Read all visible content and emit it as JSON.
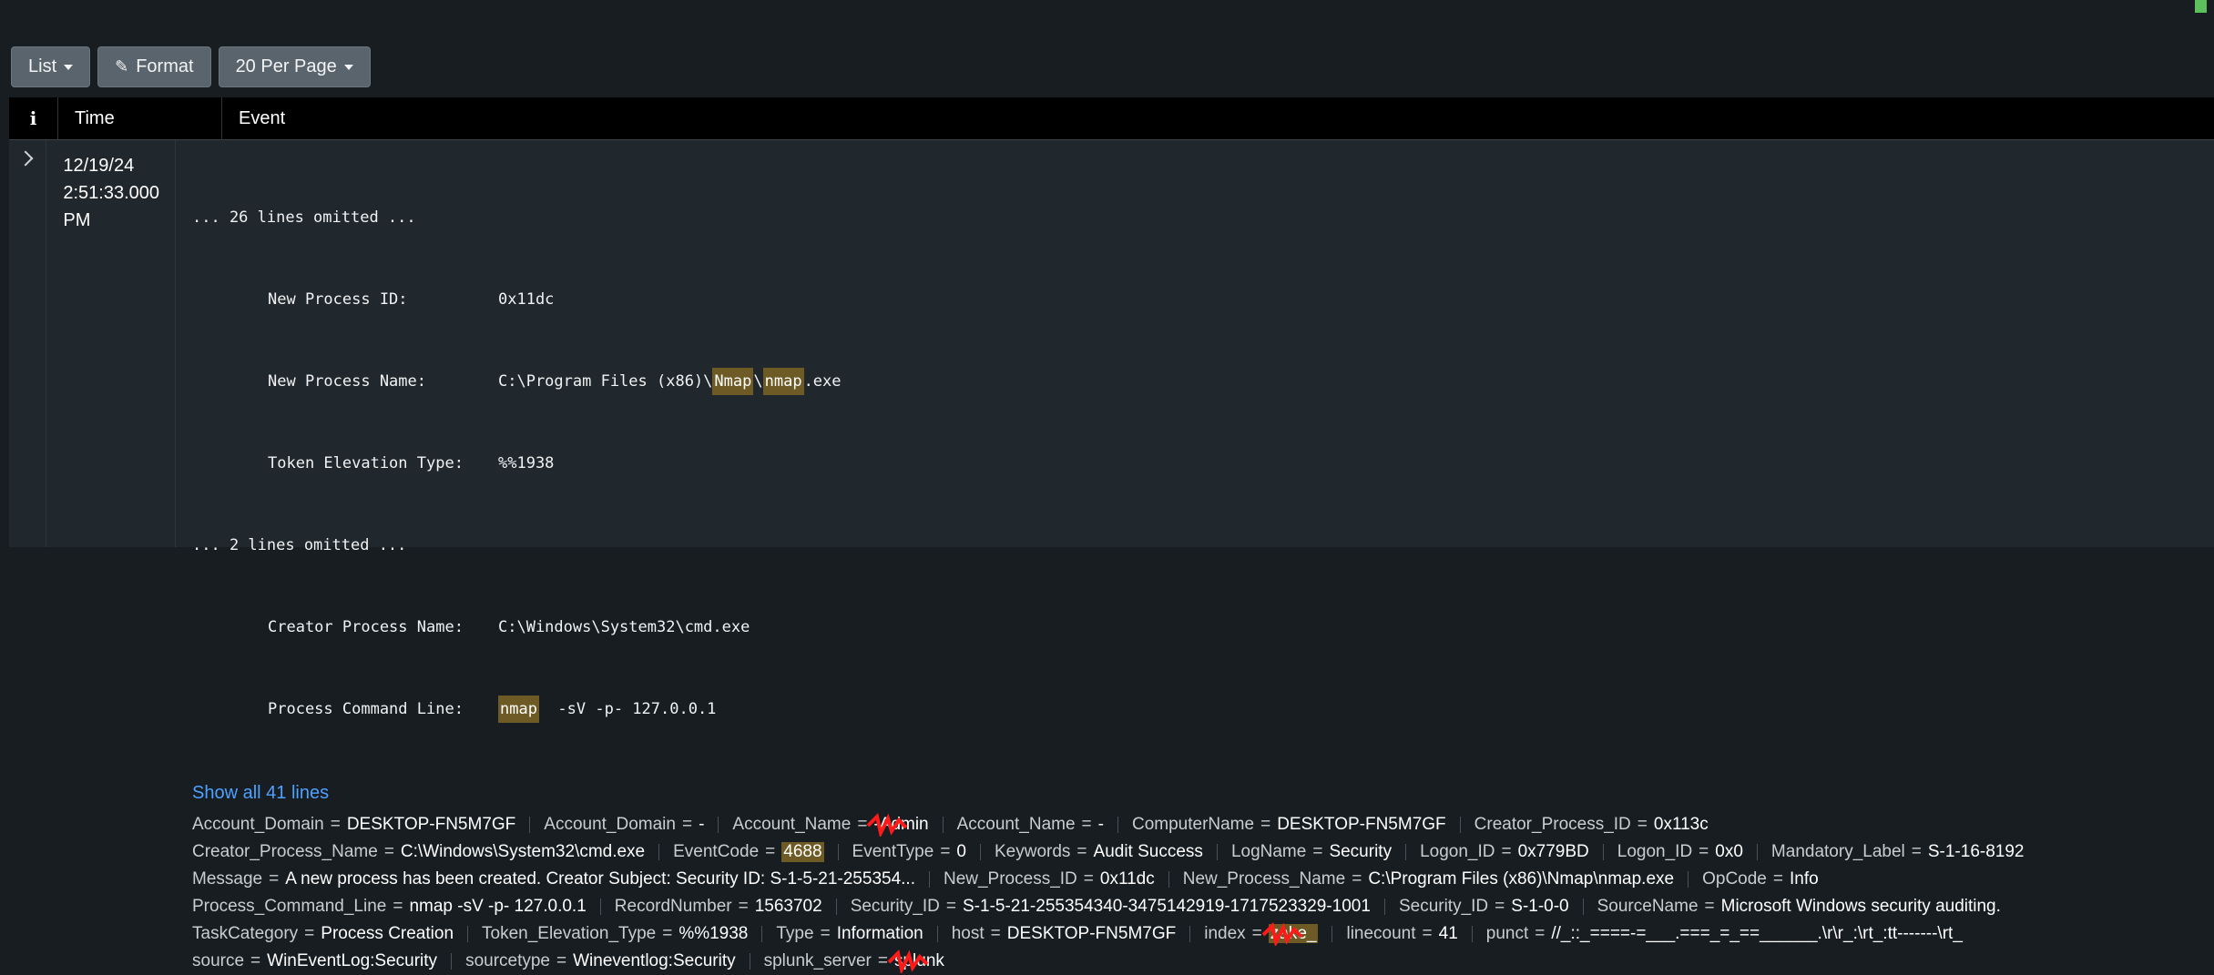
{
  "toolbar": {
    "list_label": "List",
    "format_label": "Format",
    "perpage_label": "20 Per Page"
  },
  "table": {
    "col_info": "i",
    "col_time": "Time",
    "col_event": "Event"
  },
  "event": {
    "date": "12/19/24",
    "time": "2:51:33.000 PM",
    "omitted1": "... 26 lines omitted ...",
    "omitted2": "... 2 lines omitted ...",
    "lines": [
      {
        "label": "New Process ID:",
        "value": "0x11dc"
      },
      {
        "label": "New Process Name:",
        "value_pre": "C:\\Program Files (x86)\\",
        "hl1": "Nmap",
        "value_mid": "\\",
        "hl2": "nmap",
        "value_post": ".exe"
      },
      {
        "label": "Token Elevation Type:",
        "value": "%%1938"
      },
      {
        "label": "Creator Process Name:",
        "value": "C:\\Windows\\System32\\cmd.exe"
      },
      {
        "label": "Process Command Line:",
        "hl": "nmap",
        "value_post": "  -sV -p- 127.0.0.1"
      }
    ],
    "show_all": "Show all 41 lines"
  },
  "fields": {
    "r1": [
      [
        "Account_Domain",
        "DESKTOP-FN5M7GF"
      ],
      [
        "Account_Domain",
        "-"
      ],
      [
        "Account_Name",
        "-Admin"
      ],
      [
        "Account_Name",
        "-"
      ],
      [
        "ComputerName",
        "DESKTOP-FN5M7GF"
      ],
      [
        "Creator_Process_ID",
        "0x113c"
      ]
    ],
    "r2": [
      [
        "Creator_Process_Name",
        "C:\\Windows\\System32\\cmd.exe"
      ],
      [
        "EventCode",
        "4688"
      ],
      [
        "EventType",
        "0"
      ],
      [
        "Keywords",
        "Audit Success"
      ],
      [
        "LogName",
        "Security"
      ],
      [
        "Logon_ID",
        "0x779BD"
      ],
      [
        "Logon_ID",
        "0x0"
      ],
      [
        "Mandatory_Label",
        "S-1-16-8192"
      ]
    ],
    "r3": [
      [
        "Message",
        "A new process has been created. Creator Subject: Security ID: S-1-5-21-255354..."
      ],
      [
        "New_Process_ID",
        "0x11dc"
      ],
      [
        "New_Process_Name",
        "C:\\Program Files (x86)\\Nmap\\nmap.exe"
      ],
      [
        "OpCode",
        "Info"
      ]
    ],
    "r4": [
      [
        "Process_Command_Line",
        "nmap -sV -p- 127.0.0.1"
      ],
      [
        "RecordNumber",
        "1563702"
      ],
      [
        "Security_ID",
        "S-1-5-21-255354340-3475142919-1717523329-1001"
      ],
      [
        "Security_ID",
        "S-1-0-0"
      ],
      [
        "SourceName",
        "Microsoft Windows security auditing."
      ]
    ],
    "r5": [
      [
        "TaskCategory",
        "Process Creation"
      ],
      [
        "Token_Elevation_Type",
        "%%1938"
      ],
      [
        "Type",
        "Information"
      ],
      [
        "host",
        "DESKTOP-FN5M7GF"
      ],
      [
        "index",
        "zake_"
      ],
      [
        "linecount",
        "41"
      ],
      [
        "punct",
        "//_::_====-=___.===_=_==______.\\r\\r_:\\rt_:tt-------\\rt_"
      ]
    ],
    "r6": [
      [
        "source",
        "WinEventLog:Security"
      ],
      [
        "sourcetype",
        "Wineventlog:Security"
      ],
      [
        "splunk_server",
        "splunk"
      ]
    ]
  },
  "colors": {
    "highlight": "#6e5a24",
    "link": "#4ea1ff",
    "redaction": "#ff1a1a"
  }
}
